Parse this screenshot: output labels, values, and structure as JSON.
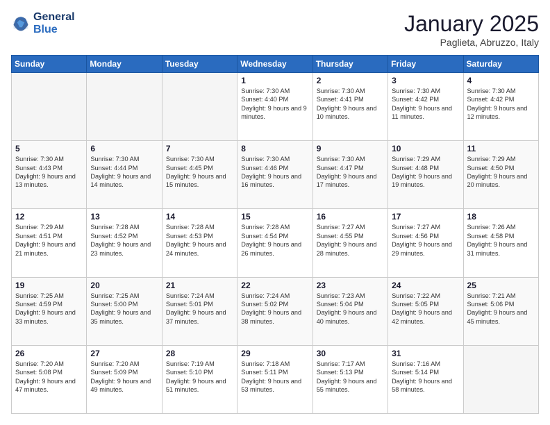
{
  "logo": {
    "line1": "General",
    "line2": "Blue"
  },
  "header": {
    "month": "January 2025",
    "location": "Paglieta, Abruzzo, Italy"
  },
  "days": [
    "Sunday",
    "Monday",
    "Tuesday",
    "Wednesday",
    "Thursday",
    "Friday",
    "Saturday"
  ],
  "weeks": [
    [
      {
        "day": "",
        "content": ""
      },
      {
        "day": "",
        "content": ""
      },
      {
        "day": "",
        "content": ""
      },
      {
        "day": "1",
        "content": "Sunrise: 7:30 AM\nSunset: 4:40 PM\nDaylight: 9 hours and 9 minutes."
      },
      {
        "day": "2",
        "content": "Sunrise: 7:30 AM\nSunset: 4:41 PM\nDaylight: 9 hours and 10 minutes."
      },
      {
        "day": "3",
        "content": "Sunrise: 7:30 AM\nSunset: 4:42 PM\nDaylight: 9 hours and 11 minutes."
      },
      {
        "day": "4",
        "content": "Sunrise: 7:30 AM\nSunset: 4:42 PM\nDaylight: 9 hours and 12 minutes."
      }
    ],
    [
      {
        "day": "5",
        "content": "Sunrise: 7:30 AM\nSunset: 4:43 PM\nDaylight: 9 hours and 13 minutes."
      },
      {
        "day": "6",
        "content": "Sunrise: 7:30 AM\nSunset: 4:44 PM\nDaylight: 9 hours and 14 minutes."
      },
      {
        "day": "7",
        "content": "Sunrise: 7:30 AM\nSunset: 4:45 PM\nDaylight: 9 hours and 15 minutes."
      },
      {
        "day": "8",
        "content": "Sunrise: 7:30 AM\nSunset: 4:46 PM\nDaylight: 9 hours and 16 minutes."
      },
      {
        "day": "9",
        "content": "Sunrise: 7:30 AM\nSunset: 4:47 PM\nDaylight: 9 hours and 17 minutes."
      },
      {
        "day": "10",
        "content": "Sunrise: 7:29 AM\nSunset: 4:48 PM\nDaylight: 9 hours and 19 minutes."
      },
      {
        "day": "11",
        "content": "Sunrise: 7:29 AM\nSunset: 4:50 PM\nDaylight: 9 hours and 20 minutes."
      }
    ],
    [
      {
        "day": "12",
        "content": "Sunrise: 7:29 AM\nSunset: 4:51 PM\nDaylight: 9 hours and 21 minutes."
      },
      {
        "day": "13",
        "content": "Sunrise: 7:28 AM\nSunset: 4:52 PM\nDaylight: 9 hours and 23 minutes."
      },
      {
        "day": "14",
        "content": "Sunrise: 7:28 AM\nSunset: 4:53 PM\nDaylight: 9 hours and 24 minutes."
      },
      {
        "day": "15",
        "content": "Sunrise: 7:28 AM\nSunset: 4:54 PM\nDaylight: 9 hours and 26 minutes."
      },
      {
        "day": "16",
        "content": "Sunrise: 7:27 AM\nSunset: 4:55 PM\nDaylight: 9 hours and 28 minutes."
      },
      {
        "day": "17",
        "content": "Sunrise: 7:27 AM\nSunset: 4:56 PM\nDaylight: 9 hours and 29 minutes."
      },
      {
        "day": "18",
        "content": "Sunrise: 7:26 AM\nSunset: 4:58 PM\nDaylight: 9 hours and 31 minutes."
      }
    ],
    [
      {
        "day": "19",
        "content": "Sunrise: 7:25 AM\nSunset: 4:59 PM\nDaylight: 9 hours and 33 minutes."
      },
      {
        "day": "20",
        "content": "Sunrise: 7:25 AM\nSunset: 5:00 PM\nDaylight: 9 hours and 35 minutes."
      },
      {
        "day": "21",
        "content": "Sunrise: 7:24 AM\nSunset: 5:01 PM\nDaylight: 9 hours and 37 minutes."
      },
      {
        "day": "22",
        "content": "Sunrise: 7:24 AM\nSunset: 5:02 PM\nDaylight: 9 hours and 38 minutes."
      },
      {
        "day": "23",
        "content": "Sunrise: 7:23 AM\nSunset: 5:04 PM\nDaylight: 9 hours and 40 minutes."
      },
      {
        "day": "24",
        "content": "Sunrise: 7:22 AM\nSunset: 5:05 PM\nDaylight: 9 hours and 42 minutes."
      },
      {
        "day": "25",
        "content": "Sunrise: 7:21 AM\nSunset: 5:06 PM\nDaylight: 9 hours and 45 minutes."
      }
    ],
    [
      {
        "day": "26",
        "content": "Sunrise: 7:20 AM\nSunset: 5:08 PM\nDaylight: 9 hours and 47 minutes."
      },
      {
        "day": "27",
        "content": "Sunrise: 7:20 AM\nSunset: 5:09 PM\nDaylight: 9 hours and 49 minutes."
      },
      {
        "day": "28",
        "content": "Sunrise: 7:19 AM\nSunset: 5:10 PM\nDaylight: 9 hours and 51 minutes."
      },
      {
        "day": "29",
        "content": "Sunrise: 7:18 AM\nSunset: 5:11 PM\nDaylight: 9 hours and 53 minutes."
      },
      {
        "day": "30",
        "content": "Sunrise: 7:17 AM\nSunset: 5:13 PM\nDaylight: 9 hours and 55 minutes."
      },
      {
        "day": "31",
        "content": "Sunrise: 7:16 AM\nSunset: 5:14 PM\nDaylight: 9 hours and 58 minutes."
      },
      {
        "day": "",
        "content": ""
      }
    ]
  ]
}
